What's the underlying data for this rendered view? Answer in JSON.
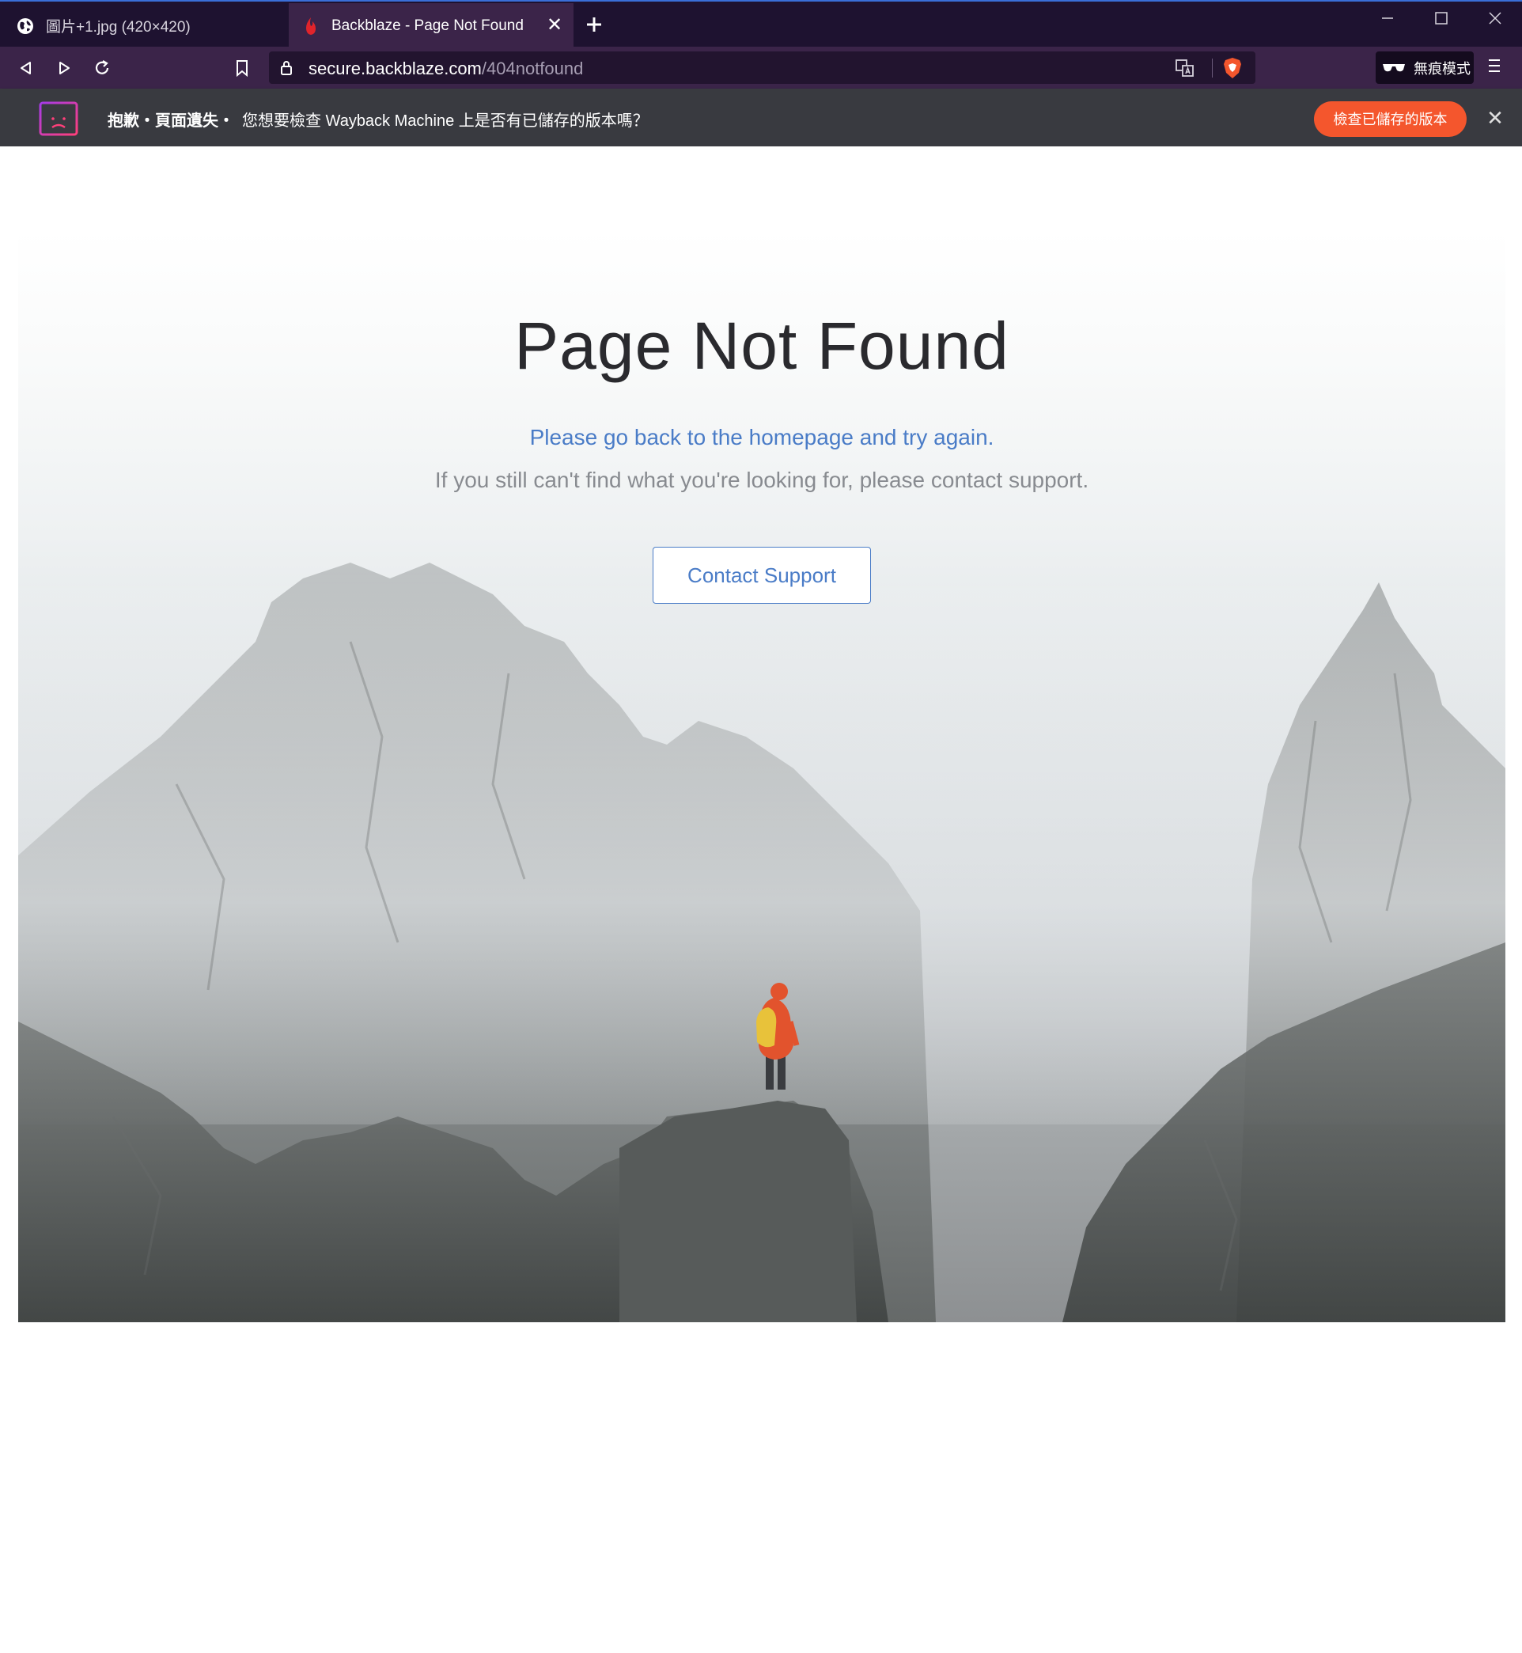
{
  "browser": {
    "tabs": [
      {
        "title": "圖片+1.jpg (420×420)",
        "active": false,
        "icon": "globe-icon"
      },
      {
        "title": "Backblaze - Page Not Found",
        "active": true,
        "icon": "backblaze-flame-icon"
      }
    ],
    "new_tab_icon": "plus-icon",
    "window_controls": {
      "minimize": "—",
      "maximize": "☐",
      "close": "✕"
    },
    "url": {
      "host": "secure.backblaze.com",
      "path": "/404notfound"
    },
    "private_mode_label": "無痕模式",
    "colors": {
      "titlebar": "#1e1230",
      "toolbar": "#3b2449",
      "accent_orange": "#f4562d"
    }
  },
  "infobar": {
    "bold_text": "抱歉・頁面遺失・",
    "message": "您想要檢查 Wayback Machine 上是否有已儲存的版本嗎？",
    "button_label": "檢查已儲存的版本",
    "close_glyph": "✕"
  },
  "page": {
    "title": "Page Not Found",
    "homepage_line": "Please go back to the homepage and try again.",
    "support_line": "If you still can't find what you're looking for, please contact support.",
    "contact_button": "Contact Support",
    "colors": {
      "link_blue": "#4a7cc7",
      "title": "#2a2a2e",
      "muted": "#888b90"
    }
  }
}
